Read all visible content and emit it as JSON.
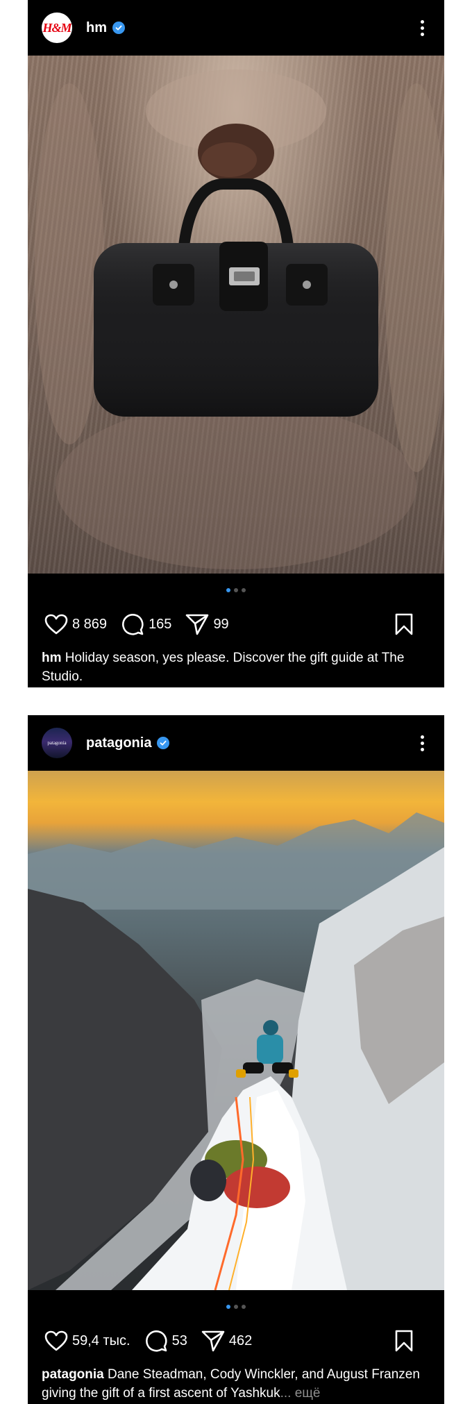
{
  "posts": [
    {
      "username": "hm",
      "avatar_text": "H&M",
      "verified": true,
      "media": "fur-coat-handbag-photo",
      "carousel": {
        "count": 3,
        "active": 1
      },
      "likes": "8 869",
      "comments": "165",
      "shares": "99",
      "caption_user": "hm",
      "caption_text": "Holiday season, yes please. Discover the gift guide at The Studio.",
      "caption_more": ""
    },
    {
      "username": "patagonia",
      "avatar_text": "patagonia",
      "verified": true,
      "media": "mountain-climber-summit-photo",
      "carousel": {
        "count": 3,
        "active": 1
      },
      "likes": "59,4 тыс.",
      "comments": "53",
      "shares": "462",
      "caption_user": "patagonia",
      "caption_text": "Dane Steadman, Cody Winckler, and August Franzen giving the gift of a first ascent of Yashkuk",
      "caption_more": "... ещё"
    }
  ],
  "icons": {
    "like": "heart-icon",
    "comment": "comment-icon",
    "share": "share-icon",
    "save": "bookmark-icon",
    "more": "more-options-icon",
    "verified": "verified-badge-icon"
  },
  "colors": {
    "accent": "#3897f0",
    "background": "#000000",
    "text": "#ffffff",
    "muted": "#8e8e8e",
    "hm_brand": "#e50010"
  }
}
